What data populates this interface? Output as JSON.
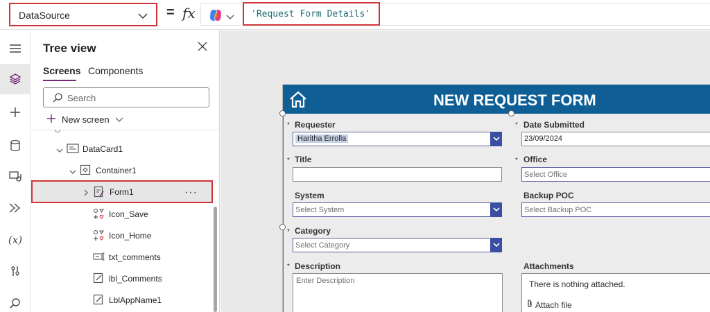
{
  "formula_bar": {
    "property": "DataSource",
    "equals": "=",
    "fx": "fx",
    "formula": "'Request Form Details'"
  },
  "rail": {
    "items": [
      "hamburger-icon",
      "layers-icon",
      "plus-icon",
      "database-icon",
      "media-icon",
      "flow-icon",
      "variables-icon",
      "tools-icon",
      "search-icon"
    ],
    "active_index": 1
  },
  "tree_view": {
    "title": "Tree view",
    "tabs": [
      {
        "label": "Screens",
        "active": true
      },
      {
        "label": "Components",
        "active": false
      }
    ],
    "search_placeholder": "Search",
    "new_screen_label": "New screen",
    "nodes": [
      {
        "label": "DataCard1",
        "icon": "datacard-icon",
        "expanded": true
      },
      {
        "label": "Container1",
        "icon": "container-icon",
        "expanded": true
      },
      {
        "label": "Form1",
        "icon": "form-icon",
        "expanded": false,
        "selected": true,
        "more": "···"
      },
      {
        "label": "Icon_Save",
        "icon": "icon-control-icon"
      },
      {
        "label": "Icon_Home",
        "icon": "icon-control-icon"
      },
      {
        "label": "txt_comments",
        "icon": "text-input-icon"
      },
      {
        "label": "lbl_Comments",
        "icon": "label-icon"
      },
      {
        "label": "LblAppName1",
        "icon": "label-icon"
      }
    ]
  },
  "form": {
    "header_title": "NEW REQUEST FORM",
    "fields": {
      "requester": {
        "label": "Requester",
        "required": "*",
        "value": "Haritha Errolla"
      },
      "date_submitted": {
        "label": "Date Submitted",
        "required": "*",
        "value": "23/09/2024"
      },
      "title": {
        "label": "Title",
        "required": "*",
        "value": ""
      },
      "office": {
        "label": "Office",
        "required": "*",
        "placeholder": "Select Office"
      },
      "system": {
        "label": "System",
        "placeholder": "Select System"
      },
      "backup_poc": {
        "label": "Backup POC",
        "placeholder": "Select Backup POC"
      },
      "category": {
        "label": "Category",
        "required": "*",
        "placeholder": "Select Category"
      },
      "description": {
        "label": "Description",
        "required": "*",
        "placeholder": "Enter Description"
      },
      "attachments": {
        "label": "Attachments",
        "empty_text": "There is nothing attached.",
        "attach_label": "Attach file"
      }
    }
  }
}
